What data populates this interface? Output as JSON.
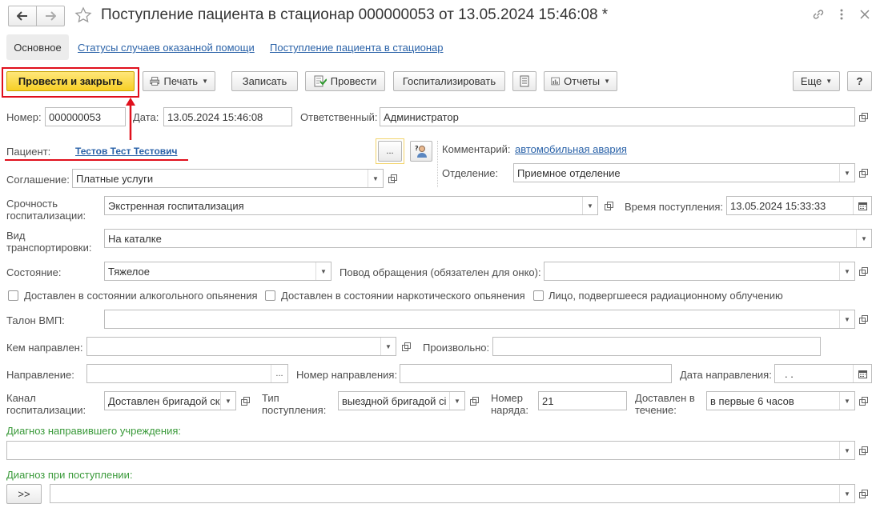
{
  "window": {
    "title": "Поступление пациента в стационар 000000053 от 13.05.2024 15:46:08 *"
  },
  "icons": {
    "back": "arrow-left-icon",
    "forward": "arrow-right-icon",
    "favorite": "star-icon",
    "link": "link-icon",
    "more": "more-vertical-icon",
    "close": "close-icon"
  },
  "tabs": [
    {
      "label": "Основное"
    },
    {
      "label": "Статусы случаев оказанной помощи"
    },
    {
      "label": "Поступление пациента в стационар"
    }
  ],
  "toolbar": {
    "post_close": "Провести и закрыть",
    "print": "Печать",
    "save": "Записать",
    "post": "Провести",
    "hospitalize": "Госпитализировать",
    "reports": "Отчеты",
    "more": "Еще",
    "help": "?"
  },
  "form": {
    "number_label": "Номер:",
    "number_value": "000000053",
    "date_label": "Дата:",
    "date_value": "13.05.2024 15:46:08",
    "responsible_label": "Ответственный:",
    "responsible_value": "Администратор",
    "patient_label": "Пациент:",
    "patient_value": "Тестов Тест Тестович",
    "patient_select": "...",
    "comment_label": "Комментарий:",
    "comment_value": "автомобильная авария",
    "agreement_label": "Соглашение:",
    "agreement_value": "Платные услуги",
    "department_label": "Отделение:",
    "department_value": "Приемное отделение",
    "urgency_label_1": "Срочность",
    "urgency_label_2": "госпитализации:",
    "urgency_value": "Экстренная госпитализация",
    "arrival_time_label": "Время поступления:",
    "arrival_time_value": "13.05.2024 15:33:33",
    "transport_label_1": "Вид",
    "transport_label_2": "транспортировки:",
    "transport_value": "На каталке",
    "condition_label": "Состояние:",
    "condition_value": "Тяжелое",
    "reason_label": "Повод обращения (обязателен для онко):",
    "reason_value": "",
    "chk_alcohol": "Доставлен в состоянии алкогольного опьянения",
    "chk_drug": "Доставлен в состоянии наркотического опьянения",
    "chk_radiation": "Лицо, подвергшееся радиационному облучению",
    "vmp_label": "Талон ВМП:",
    "vmp_value": "",
    "referred_by_label": "Кем направлен:",
    "referred_by_value": "",
    "arbitrary_label": "Произвольно:",
    "arbitrary_value": "",
    "referral_label": "Направление:",
    "referral_value": "",
    "referral_number_label": "Номер направления:",
    "referral_number_value": "",
    "referral_date_label": "Дата направления:",
    "referral_date_value": ". .",
    "channel_label_1": "Канал",
    "channel_label_2": "госпитализации:",
    "channel_value": "Доставлен бригадой ск",
    "admission_type_label_1": "Тип",
    "admission_type_label_2": "поступления:",
    "admission_type_value": "выездной бригадой сі",
    "order_number_label_1": "Номер",
    "order_number_label_2": "наряда:",
    "order_number_value": "21",
    "delivered_within_label_1": "Доставлен в",
    "delivered_within_label_2": "течение:",
    "delivered_within_value": "в первые  6 часов",
    "referring_diag_label": "Диагноз направившего учреждения:",
    "referring_diag_value": "",
    "admission_diag_label": "Диагноз при поступлении:",
    "admission_diag_value": "",
    "expand_button": ">>"
  },
  "colors": {
    "primary_button": "#f7cf25",
    "link": "#2a62a8",
    "section_label": "#3a9a3a",
    "annotation": "#e0101d"
  }
}
